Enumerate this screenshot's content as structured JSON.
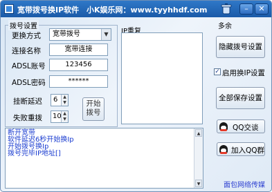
{
  "window": {
    "title": "宽带拨号换IP软件",
    "subtitle": "小K娱乐网：www.tyyhhdf.com"
  },
  "dial_settings": {
    "group_label": "拨号设置",
    "method_label": "更换方式",
    "method_value": "宽带拨号",
    "conn_name_label": "连接名称",
    "conn_name_value": "宽带连接",
    "account_label": "ADSL账号",
    "account_value": "123456",
    "password_label": "ADSL密码",
    "password_value": "******",
    "disconnect_delay_label": "挂断延迟",
    "disconnect_delay_value": "6",
    "fail_redial_label": "失败重拨",
    "fail_redial_value": "10",
    "start_dial_label": "开始拨号"
  },
  "ip_repeat": {
    "group_label": "IP重复"
  },
  "misc": {
    "group_label": "多余",
    "hide_dial_settings": "隐藏拨号设置",
    "enable_ip_settings": "启用换IP设置",
    "save_all_settings": "全部保存设置",
    "qq_chat": "QQ交谈",
    "join_qq_group": "加入QQ群"
  },
  "log": [
    "断开宽带",
    "软件延迟6秒开始换Ip",
    "开始拨号换Ip",
    "拨号完毕IP地址[]"
  ],
  "footer": "面包网络传媒"
}
